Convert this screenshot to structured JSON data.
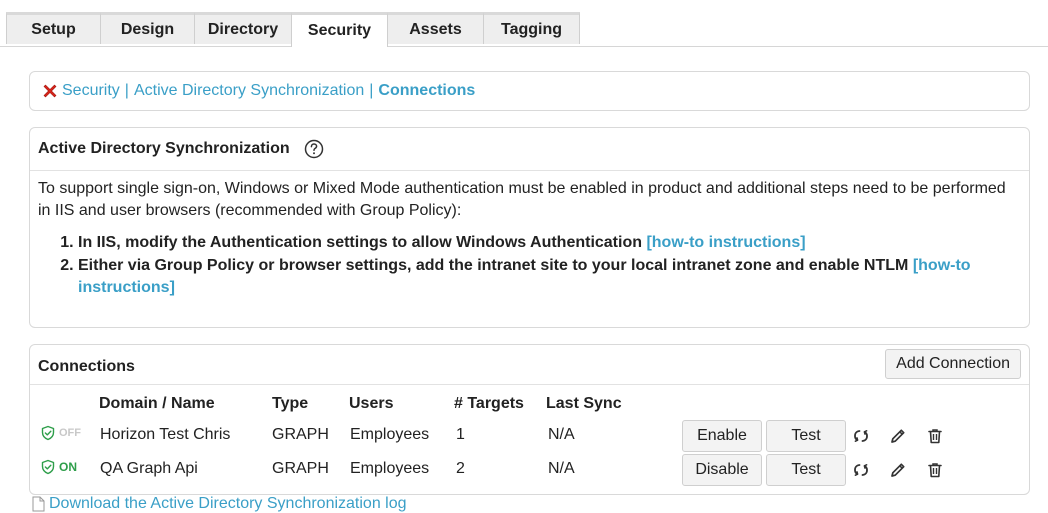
{
  "tabs": [
    {
      "label": "Setup",
      "active": false
    },
    {
      "label": "Design",
      "active": false
    },
    {
      "label": "Directory",
      "active": false
    },
    {
      "label": "Security",
      "active": true
    },
    {
      "label": "Assets",
      "active": false
    },
    {
      "label": "Tagging",
      "active": false
    }
  ],
  "breadcrumb": {
    "icon": "close-x-icon",
    "items": [
      "Security",
      "Active Directory Synchronization",
      "Connections"
    ],
    "separator": "|"
  },
  "ad_sync": {
    "title": "Active Directory Synchronization",
    "help_icon": "help-circle-icon",
    "description": "To support single sign-on, Windows or Mixed Mode authentication must be enabled in product and additional steps need to be performed in IIS and user browsers (recommended with Group Policy):",
    "steps": [
      {
        "text": "In IIS, modify the Authentication settings to allow Windows Authentication ",
        "link": "[how-to instructions]"
      },
      {
        "text": "Either via Group Policy or browser settings, add the intranet site to your local intranet zone and enable NTLM ",
        "link": "[how-to instructions]"
      }
    ]
  },
  "connections": {
    "title": "Connections",
    "add_button": "Add Connection",
    "columns": [
      "Domain / Name",
      "Type",
      "Users",
      "# Targets",
      "Last Sync"
    ],
    "rows": [
      {
        "status": "OFF",
        "name": "Horizon Test Chris",
        "type": "GRAPH",
        "users": "Employees",
        "targets": "1",
        "last_sync": "N/A",
        "toggle_label": "Enable",
        "test_label": "Test"
      },
      {
        "status": "ON",
        "name": "QA Graph Api",
        "type": "GRAPH",
        "users": "Employees",
        "targets": "2",
        "last_sync": "N/A",
        "toggle_label": "Disable",
        "test_label": "Test"
      }
    ]
  },
  "log_link": "Download the Active Directory Synchronization log",
  "colors": {
    "link": "#3a9fc7",
    "on": "#2e9e4a",
    "off": "#c8c8c8",
    "error": "#d9261c"
  }
}
